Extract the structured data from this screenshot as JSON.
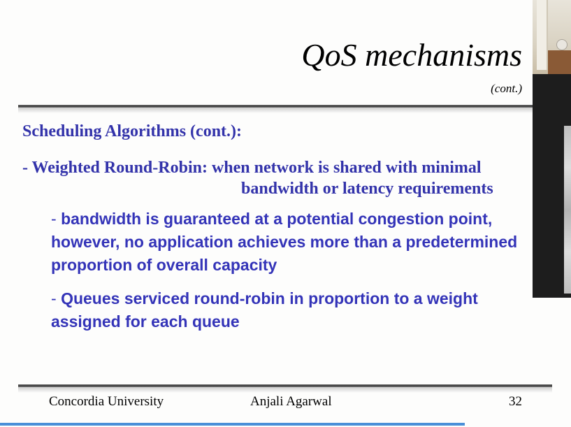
{
  "slide": {
    "title": "QoS mechanisms",
    "subtitle": "(cont.)",
    "section_heading": "Scheduling Algorithms (cont.):",
    "bullet_main_line1": "- Weighted Round-Robin: when network is shared with minimal",
    "bullet_main_line2": "bandwidth or latency requirements",
    "sub_bullets": [
      {
        "dash": "-",
        "text": "bandwidth is guaranteed at a potential congestion point, however, no application achieves more than a predetermined proportion of overall capacity"
      },
      {
        "dash": "-",
        "text": "Queues serviced round-robin in proportion to a weight assigned for each queue"
      }
    ]
  },
  "footer": {
    "left": "Concordia University",
    "center": "Anjali Agarwal",
    "page_number": "32"
  },
  "colors": {
    "heading_blue": "#3333aa",
    "body_blue": "#3434b8",
    "rule": "#333333",
    "accent_strip": "#4a8fd8"
  }
}
